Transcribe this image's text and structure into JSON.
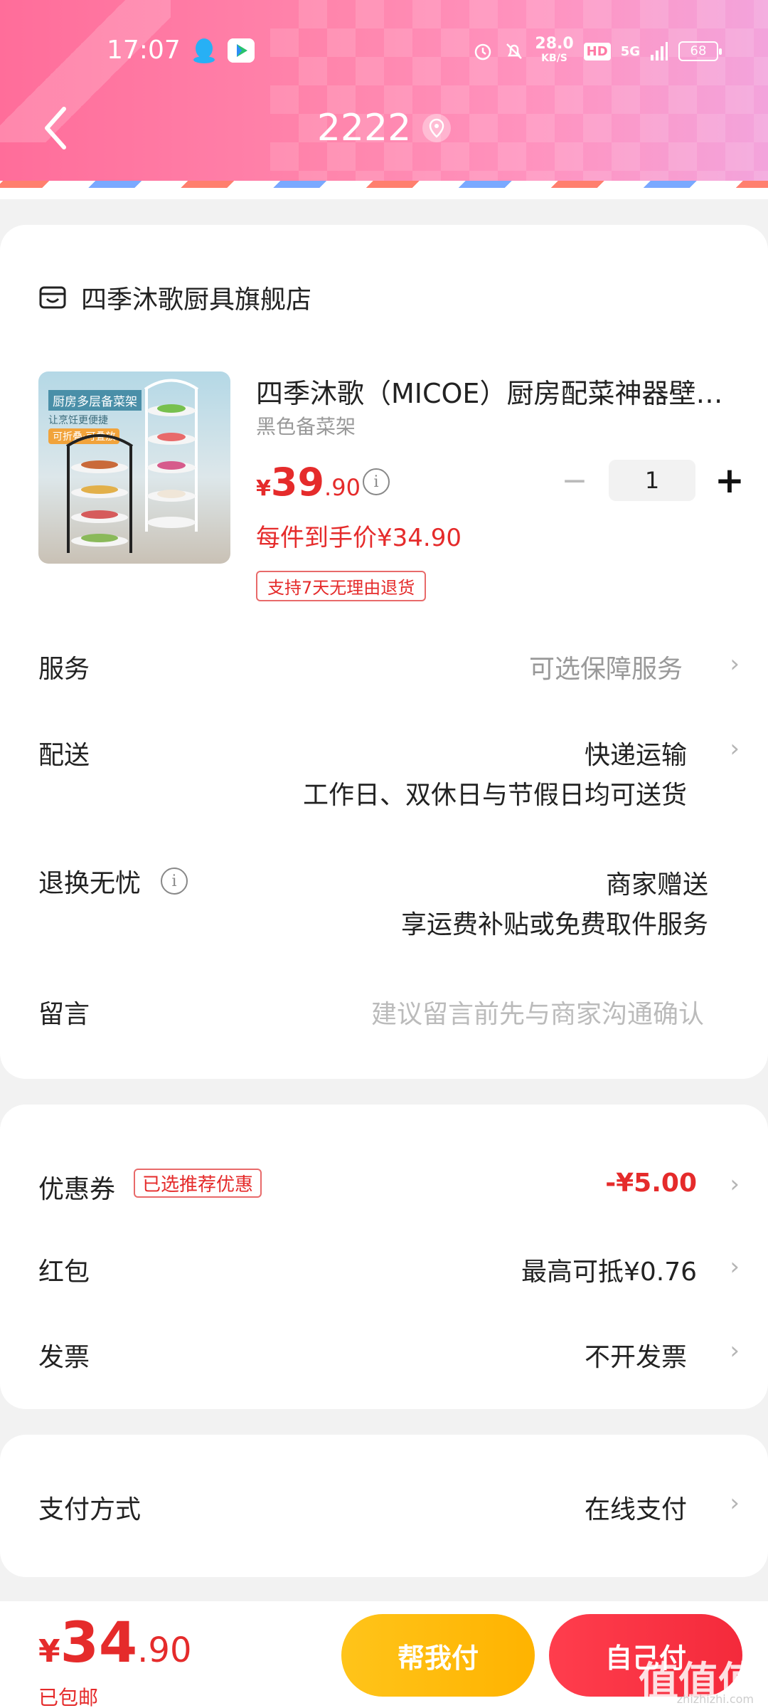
{
  "status_bar": {
    "time": "17:07",
    "net_speed": "28.0",
    "net_unit": "KB/S",
    "hd": "HD",
    "signal": "5G",
    "battery": "68"
  },
  "nav": {
    "title": "2222"
  },
  "shop": {
    "name": "四季沐歌厨具旗舰店"
  },
  "product": {
    "title": "四季沐歌（MICOE）厨房配菜神器壁…",
    "spec": "黑色备菜架",
    "price_currency": "¥",
    "price_int": "39",
    "price_dec": ".90",
    "quantity": "1",
    "deal_price": "每件到手价¥34.90",
    "return_policy": "支持7天无理由退货",
    "image_text_1": "厨房多层备菜架",
    "image_text_2": "让烹饪更便捷",
    "image_text_3": "可折叠·可叠放"
  },
  "rows": {
    "service_label": "服务",
    "service_value": "可选保障服务",
    "delivery_label": "配送",
    "delivery_value": "快递运输",
    "delivery_note": "工作日、双休日与节假日均可送货",
    "return_label": "退换无忧",
    "return_value": "商家赠送",
    "return_note": "享运费补贴或免费取件服务",
    "message_label": "留言",
    "message_placeholder": "建议留言前先与商家沟通确认"
  },
  "discounts": {
    "coupon_label": "优惠券",
    "coupon_badge": "已选推荐优惠",
    "coupon_value": "-¥5.00",
    "redpacket_label": "红包",
    "redpacket_value": "最高可抵¥0.76",
    "invoice_label": "发票",
    "invoice_value": "不开发票"
  },
  "payment": {
    "label": "支付方式",
    "value": "在线支付"
  },
  "bottom": {
    "currency": "¥",
    "total_int": "34",
    "total_dec": ".90",
    "shipping": "已包邮",
    "help_pay": "帮我付",
    "self_pay": "自己付",
    "watermark": "值值值",
    "watermark_sub": "zhizhizhi.com"
  },
  "colors": {
    "accent_red": "#e52b2b",
    "header_pink": "#ff7aa5",
    "button_yellow": "#ffc41a",
    "button_red": "#ff3d4d"
  }
}
